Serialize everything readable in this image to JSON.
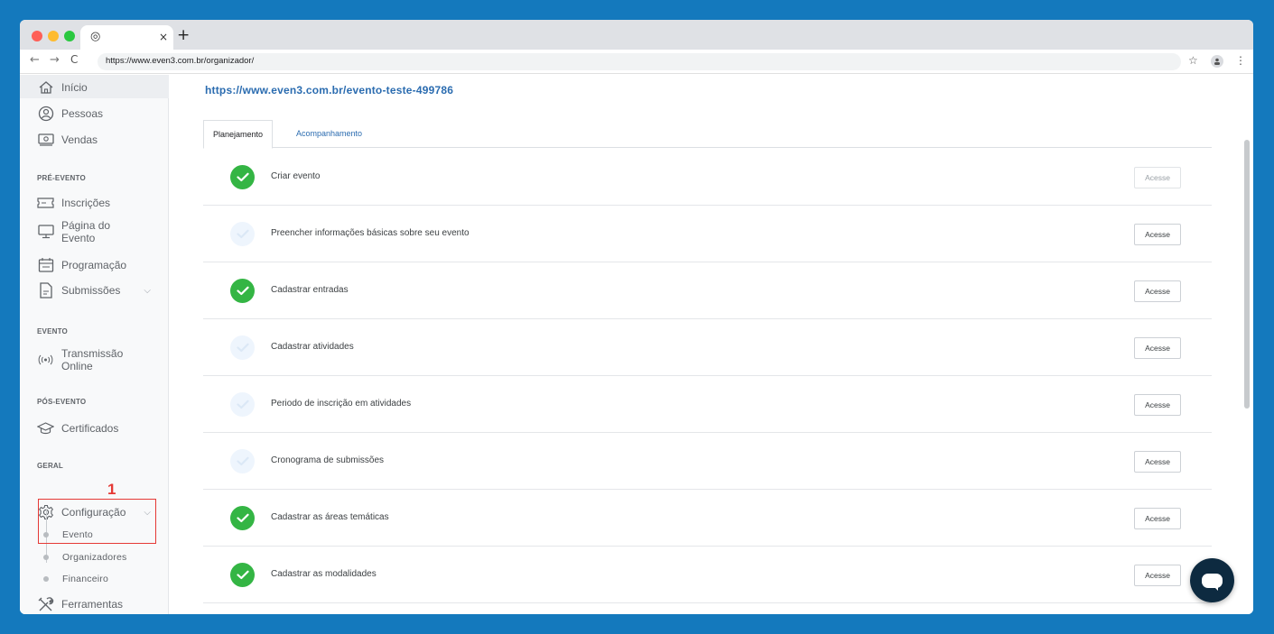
{
  "browser": {
    "url": "https://www.even3.com.br/organizador/",
    "new_tab": "+",
    "tab_close": "×",
    "back": "←",
    "forward": "→",
    "reload": "C",
    "star": "☆",
    "menu": "⋮"
  },
  "sidebar": {
    "top_items": [
      {
        "label": "Início",
        "icon": "home-icon"
      },
      {
        "label": "Pessoas",
        "icon": "person-icon"
      },
      {
        "label": "Vendas",
        "icon": "money-icon"
      }
    ],
    "sections": {
      "pre_evento": "PRÉ-EVENTO",
      "evento": "EVENTO",
      "pos_evento": "PÓS-EVENTO",
      "geral": "GERAL"
    },
    "pre_items": [
      {
        "label": "Inscrições",
        "icon": "ticket-icon"
      },
      {
        "label": "Página do Evento",
        "icon": "monitor-icon"
      },
      {
        "label": "Programação",
        "icon": "calendar-icon"
      },
      {
        "label": "Submissões",
        "icon": "document-icon"
      }
    ],
    "evento_items": [
      {
        "label": "Transmissão Online",
        "icon": "broadcast-icon"
      }
    ],
    "pos_items": [
      {
        "label": "Certificados",
        "icon": "graduation-cap-icon"
      }
    ],
    "geral_items": [
      {
        "label": "Configuração",
        "icon": "gear-icon"
      }
    ],
    "config_subitems": [
      "Evento",
      "Organizadores",
      "Financeiro"
    ],
    "ferramentas": {
      "label": "Ferramentas",
      "icon": "tools-icon"
    },
    "caret": "⌵"
  },
  "annotation": {
    "step_number": "1",
    "color": "#e53935"
  },
  "main": {
    "event_url": "https://www.even3.com.br/evento-teste-499786",
    "tabs": [
      "Planejamento",
      "Acompanhamento"
    ],
    "active_tab": "Planejamento",
    "tasks": [
      {
        "label": "Criar evento",
        "done": true,
        "button": "Acesse"
      },
      {
        "label": "Preencher informações básicas sobre seu evento",
        "done": false,
        "button": "Acesse"
      },
      {
        "label": "Cadastrar entradas",
        "done": true,
        "button": "Acesse"
      },
      {
        "label": "Cadastrar atividades",
        "done": false,
        "button": "Acesse"
      },
      {
        "label": "Periodo de inscrição em atividades",
        "done": false,
        "button": "Acesse"
      },
      {
        "label": "Cronograma de submissões",
        "done": false,
        "button": "Acesse"
      },
      {
        "label": "Cadastrar as áreas temáticas",
        "done": true,
        "button": "Acesse"
      },
      {
        "label": "Cadastrar as modalidades",
        "done": true,
        "button": "Acesse"
      }
    ]
  },
  "colors": {
    "background": "#1479bd",
    "done": "#34b544",
    "link": "#2b6cb0",
    "chat": "#0d2a40"
  }
}
